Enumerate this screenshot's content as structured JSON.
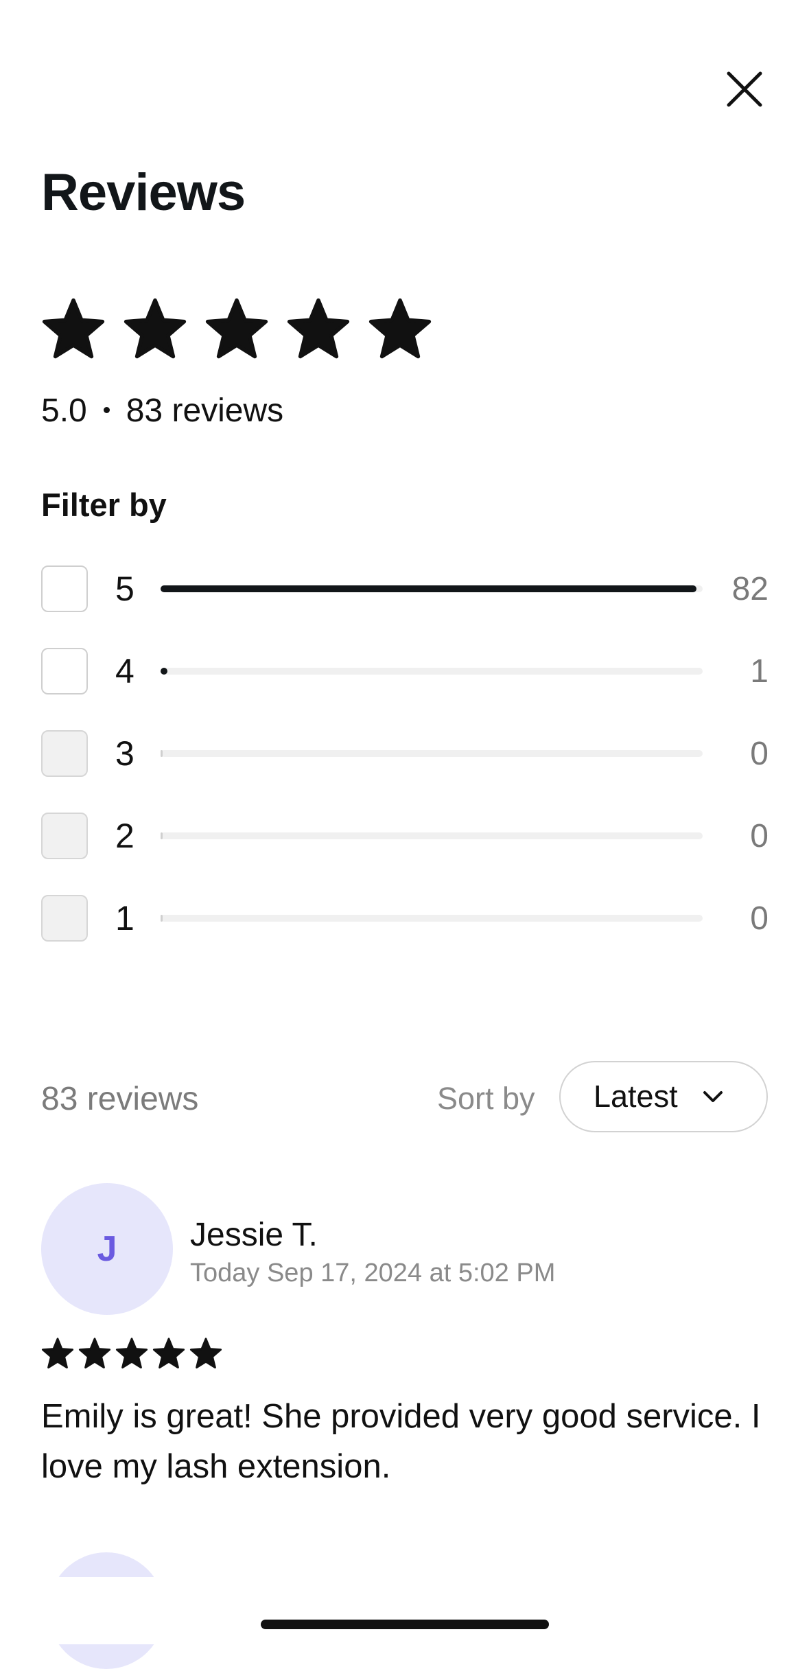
{
  "header": {
    "close_icon": "close-icon",
    "title": "Reviews"
  },
  "summary": {
    "stars_filled": 5,
    "star_icon": "star-icon",
    "rating": "5.0",
    "reviews_label": "83 reviews"
  },
  "filter": {
    "label": "Filter by",
    "rows": [
      {
        "stars": "5",
        "count": "82",
        "fraction": 0.988,
        "enabled": true
      },
      {
        "stars": "4",
        "count": "1",
        "fraction": 0.012,
        "enabled": true
      },
      {
        "stars": "3",
        "count": "0",
        "fraction": 0,
        "enabled": false
      },
      {
        "stars": "2",
        "count": "0",
        "fraction": 0,
        "enabled": false
      },
      {
        "stars": "1",
        "count": "0",
        "fraction": 0,
        "enabled": false
      }
    ]
  },
  "list_header": {
    "count_label": "83 reviews",
    "sort_label": "Sort by",
    "sort_value": "Latest",
    "dropdown_icon": "chevron-down-icon"
  },
  "reviews": [
    {
      "initial": "J",
      "name": "Jessie T.",
      "date": "Today Sep 17, 2024 at 5:02 PM",
      "stars": 5,
      "text": "Emily is great! She provided very good service. I love my lash extension."
    }
  ],
  "colors": {
    "text_primary": "#111111",
    "text_secondary": "#7a7a7a",
    "bar_fill": "#121619",
    "bar_track": "#f0f0f0",
    "avatar_bg": "#e6e6fb",
    "avatar_text": "#6a5ae0"
  }
}
